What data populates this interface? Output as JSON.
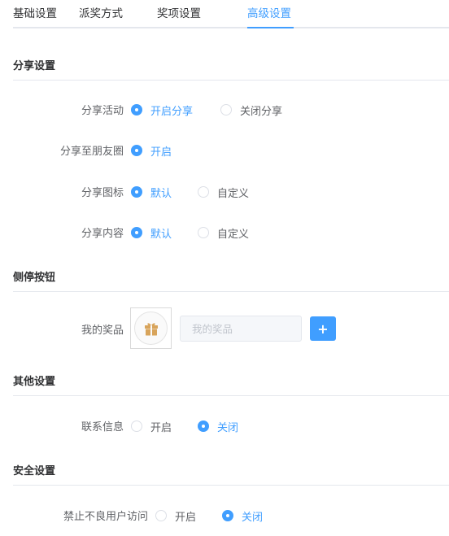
{
  "tabs": [
    {
      "label": "基础设置",
      "active": false
    },
    {
      "label": "派奖方式",
      "active": false
    },
    {
      "label": "奖项设置",
      "active": false
    },
    {
      "label": "高级设置",
      "active": true
    }
  ],
  "share_section": {
    "title": "分享设置",
    "activity": {
      "label": "分享活动",
      "options": [
        "开启分享",
        "关闭分享"
      ],
      "selected": "开启分享"
    },
    "moments": {
      "label": "分享至朋友圈",
      "options": [
        "开启"
      ],
      "selected": "开启"
    },
    "icon": {
      "label": "分享图标",
      "options": [
        "默认",
        "自定义"
      ],
      "selected": "默认"
    },
    "content": {
      "label": "分享内容",
      "options": [
        "默认",
        "自定义"
      ],
      "selected": "默认"
    }
  },
  "side_button_section": {
    "title": "侧停按钮",
    "prize": {
      "label": "我的奖品",
      "input_placeholder": "我的奖品",
      "input_value": "",
      "add_label": "+",
      "icon": "gift-icon"
    }
  },
  "other_section": {
    "title": "其他设置",
    "contact": {
      "label": "联系信息",
      "options": [
        "开启",
        "关闭"
      ],
      "selected": "关闭"
    }
  },
  "security_section": {
    "title": "安全设置",
    "block_bad_users": {
      "label": "禁止不良用户访问",
      "options": [
        "开启",
        "关闭"
      ],
      "selected": "关闭"
    }
  },
  "colors": {
    "accent": "#409eff",
    "gift": "#d8a45b"
  }
}
